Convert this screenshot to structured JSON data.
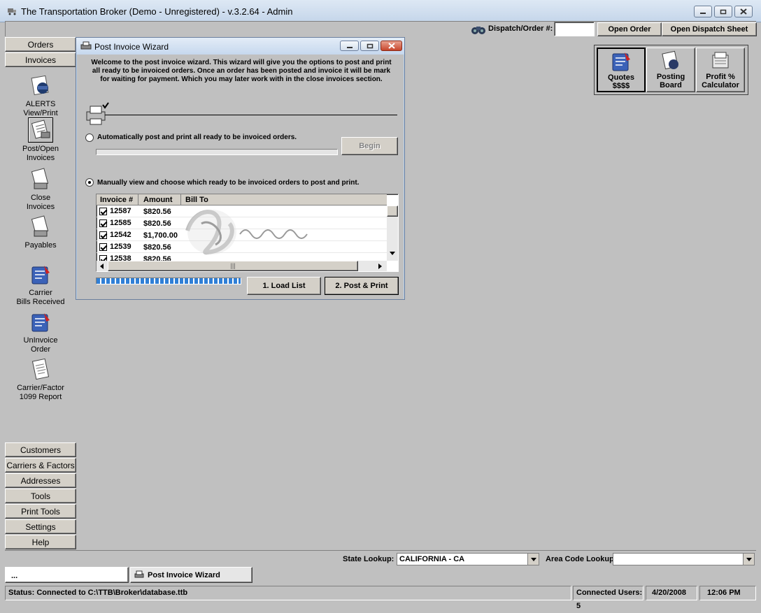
{
  "window": {
    "title": "The Transportation Broker (Demo - Unregistered) - v.3.2.64 - Admin"
  },
  "toolbar": {
    "dispatch_label": "Dispatch/Order #:",
    "dispatch_value": "",
    "open_order_label": "Open Order",
    "open_dispatch_label": "Open Dispatch Sheet"
  },
  "nav": {
    "top_buttons": [
      "Orders",
      "Invoices"
    ],
    "items": [
      {
        "line1": "ALERTS",
        "line2": "View/Print",
        "icon": "alerts-icon"
      },
      {
        "line1": "Post/Open",
        "line2": "Invoices",
        "icon": "post-invoices-icon"
      },
      {
        "line1": "Close",
        "line2": "Invoices",
        "icon": "close-invoices-icon"
      },
      {
        "line1": "Payables",
        "line2": "",
        "icon": "payables-icon"
      },
      {
        "line1": "Carrier",
        "line2": "Bills Received",
        "icon": "carrier-bills-icon"
      },
      {
        "line1": "UnInvoice",
        "line2": "Order",
        "icon": "uninvoice-icon"
      },
      {
        "line1": "Carrier/Factor",
        "line2": "1099 Report",
        "icon": "report-1099-icon"
      }
    ],
    "bottom_buttons": [
      "Customers",
      "Carriers & Factors",
      "Addresses",
      "Tools",
      "Print Tools",
      "Settings",
      "Help"
    ]
  },
  "quick": [
    {
      "line1": "Quotes",
      "line2": "$$$$"
    },
    {
      "line1": "Posting",
      "line2": "Board"
    },
    {
      "line1": "Profit %",
      "line2": "Calculator"
    }
  ],
  "dialog": {
    "title": "Post Invoice Wizard",
    "intro": "Welcome to the post invoice wizard. This wizard will give you the options to post and print all ready to be invoiced orders. Once an order has been posted and invoice it will be mark for waiting for payment. Which you may later work with in the close invoices section.",
    "option_auto": "Automatically post and print all ready to be invoiced orders.",
    "begin_label": "Begin",
    "option_manual": "Manually view and choose which ready to be invoiced orders to post and print.",
    "columns": [
      "Invoice #",
      "Amount",
      "Bill To"
    ],
    "rows": [
      {
        "invoice": "12587",
        "amount": "$820.56"
      },
      {
        "invoice": "12585",
        "amount": "$820.56"
      },
      {
        "invoice": "12542",
        "amount": "$1,700.00"
      },
      {
        "invoice": "12539",
        "amount": "$820.56"
      },
      {
        "invoice": "12538",
        "amount": "$820.56"
      }
    ],
    "load_label": "1. Load List",
    "post_label": "2. Post & Print",
    "progress": 1.0
  },
  "lookup": {
    "state_label": "State Lookup:",
    "state_value": "CALIFORNIA - CA",
    "area_label": "Area Code Lookup:",
    "area_value": ""
  },
  "taskbar": {
    "item1": "...",
    "item2": "Post Invoice Wizard"
  },
  "status": {
    "connection": "Status: Connected to C:\\TTB\\Broker\\database.ttb",
    "users": "Connected Users: 5",
    "date": "4/20/2008",
    "time": "12:06 PM"
  },
  "colors": {
    "progress": "#2f7fd6",
    "face": "#c0c0c0"
  }
}
